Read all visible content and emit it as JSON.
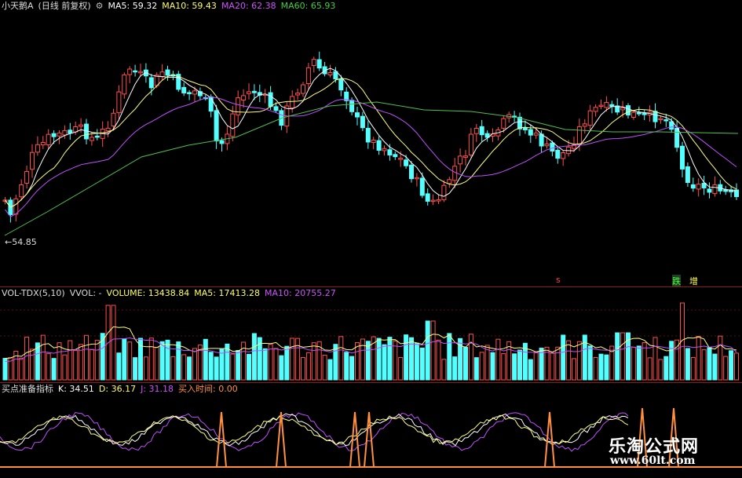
{
  "price_header": {
    "stock_name": "小天鹅A",
    "period": "(日线 前复权)",
    "ma5": "MA5: 59.32",
    "ma10": "MA10: 59.43",
    "ma20": "MA20: 62.38",
    "ma60": "MA60: 65.93"
  },
  "price_annotation": "←54.85",
  "markers": {
    "left": "s",
    "fall": "跌",
    "rise": "增"
  },
  "vol_header": {
    "name": "VOL-TDX(5,10)",
    "vvol": "VVOL: -",
    "volume": "VOLUME: 13438.84",
    "ma5": "MA5: 17413.28",
    "ma10": "MA10: 20755.27"
  },
  "ind_header": {
    "name": "买点准备指标",
    "k": "K: 34.51",
    "d": "D: 36.17",
    "j": "J: 31.18",
    "buy_time": "买入时间: 0.00"
  },
  "watermark": {
    "title": "乐淘公式网",
    "url": "www.60lt.com"
  },
  "colors": {
    "up": "#ff5050",
    "down": "#54ffff",
    "ma5": "#ffffff",
    "ma10": "#ffff80",
    "ma20": "#c050ff",
    "ma60": "#50c050",
    "ind_k": "#ffffff",
    "ind_d": "#ffff80",
    "ind_j": "#c050ff",
    "buy_signal": "#ff9040"
  }
}
